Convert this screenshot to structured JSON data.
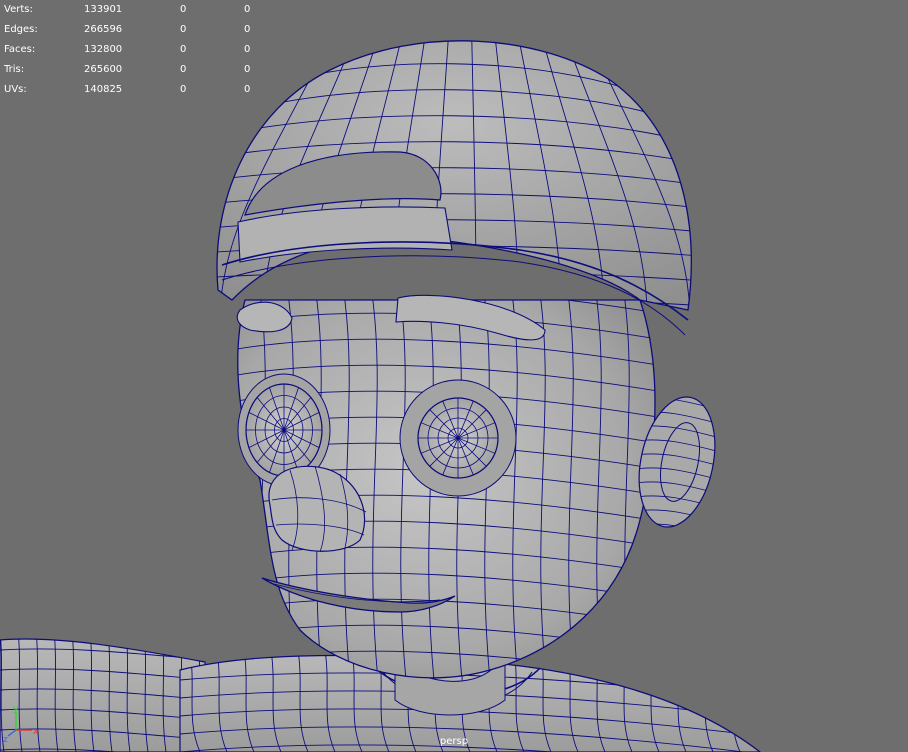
{
  "hud": {
    "rows": [
      {
        "label": "Verts:",
        "total": "133901",
        "selected": "0",
        "component": "0"
      },
      {
        "label": "Edges:",
        "total": "266596",
        "selected": "0",
        "component": "0"
      },
      {
        "label": "Faces:",
        "total": "132800",
        "selected": "0",
        "component": "0"
      },
      {
        "label": "Tris:",
        "total": "265600",
        "selected": "0",
        "component": "0"
      },
      {
        "label": "UVs:",
        "total": "140825",
        "selected": "0",
        "component": "0"
      }
    ]
  },
  "camera": {
    "name": "persp"
  },
  "axis": {
    "x": "x",
    "y": "y",
    "z": "z"
  },
  "colors": {
    "background": "#6e6e6e",
    "mesh_shade": "#b4b4b4",
    "wireframe": "#0c0c7a",
    "hud_text": "#ffffff",
    "axis_x": "#e03a3a",
    "axis_y": "#3ad03a",
    "axis_z": "#3a6ae0"
  }
}
